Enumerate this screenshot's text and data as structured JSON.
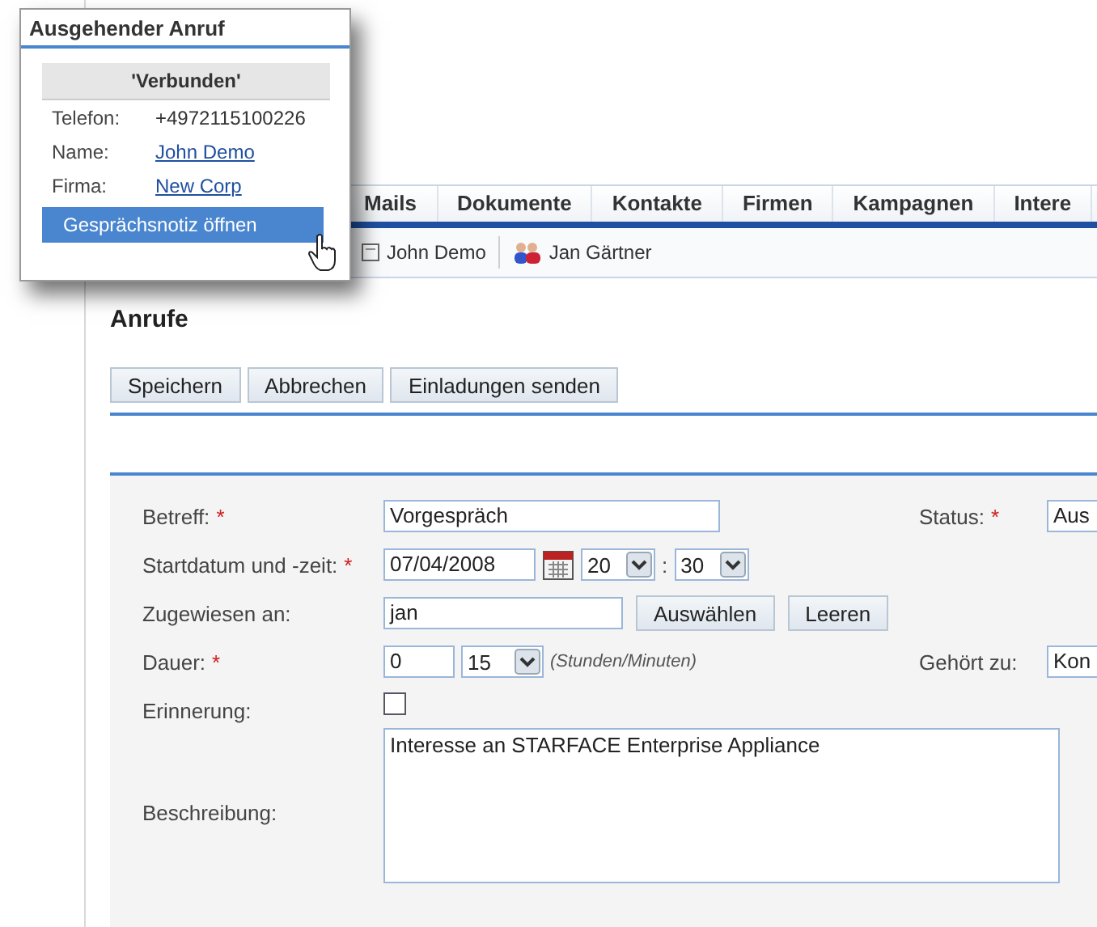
{
  "popup": {
    "title": "Ausgehender Anruf",
    "status": "'Verbunden'",
    "fields": [
      {
        "label": "Telefon:",
        "value": "+4972115100226",
        "kind": "text"
      },
      {
        "label": "Name:",
        "value": "John Demo",
        "kind": "link"
      },
      {
        "label": "Firma:",
        "value": "New Corp",
        "kind": "link"
      }
    ],
    "action": "Gesprächsnotiz öffnen"
  },
  "tabs": [
    {
      "label": "Mails"
    },
    {
      "label": "Dokumente"
    },
    {
      "label": "Kontakte"
    },
    {
      "label": "Firmen"
    },
    {
      "label": "Kampagnen"
    },
    {
      "label": "Intere"
    }
  ],
  "recent": [
    {
      "label": "John Demo",
      "kind": "record"
    },
    {
      "label": "Jan Gärtner",
      "kind": "users"
    }
  ],
  "heading": "Anrufe",
  "buttons": [
    "Speichern",
    "Abbrechen",
    "Einladungen senden"
  ],
  "form": {
    "rows": [
      {
        "label": "Betreff:",
        "required_mark": "*",
        "kind": "text",
        "value": "Vorgespräch",
        "side": {
          "label": "Status:",
          "required_mark": "*",
          "value": "Aus"
        }
      },
      {
        "label": "Startdatum und -zeit:",
        "required_mark": "*",
        "kind": "datetime",
        "date": "07/04/2008",
        "hour": "20",
        "separator": ":",
        "minute": "30"
      },
      {
        "label": "Zugewiesen an:",
        "kind": "assign",
        "value": "jan",
        "buttons": [
          "Auswählen",
          "Leeren"
        ]
      },
      {
        "label": "Dauer:",
        "required_mark": "*",
        "kind": "duration",
        "hours": "0",
        "minutes": "15",
        "hint": "(Stunden/Minuten)",
        "side": {
          "label": "Gehört zu:",
          "value": "Kon"
        }
      },
      {
        "label": "Erinnerung:",
        "kind": "checkbox",
        "checked": false
      },
      {
        "label": "Beschreibung:",
        "kind": "textarea",
        "value": "Interesse an STARFACE Enterprise Appliance"
      }
    ]
  }
}
